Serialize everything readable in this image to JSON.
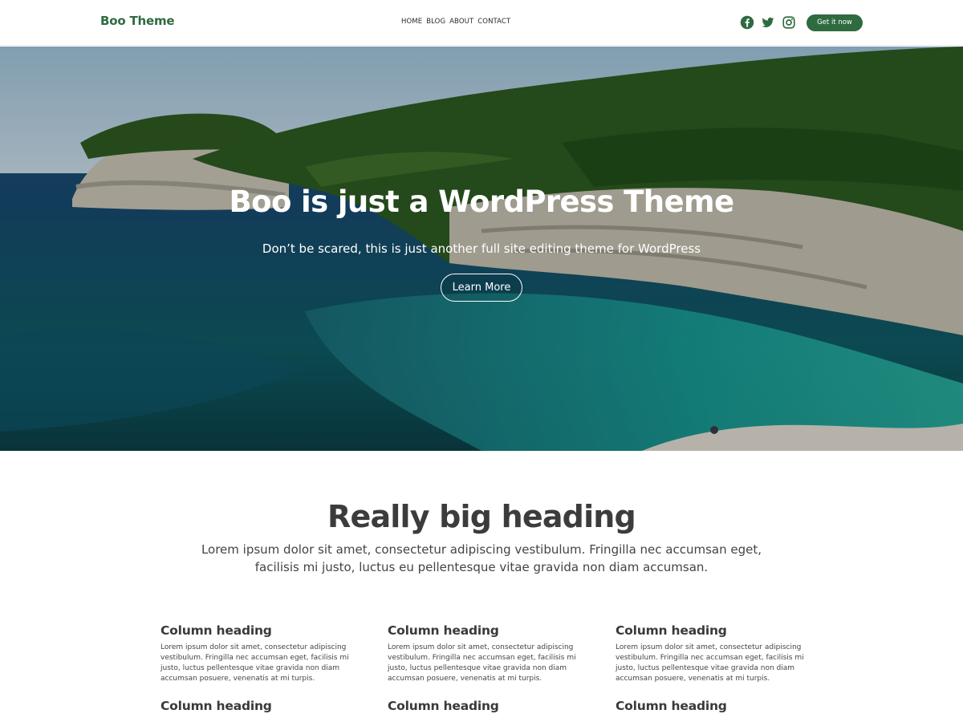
{
  "header": {
    "brand": "Boo Theme",
    "nav": [
      "HOME",
      "BLOG",
      "ABOUT",
      "CONTACT"
    ],
    "social_icons": [
      "facebook-icon",
      "twitter-icon",
      "instagram-icon"
    ],
    "cta_label": "Get it now",
    "accent_color": "#2e6b3f"
  },
  "hero": {
    "title": "Boo is just a WordPress Theme",
    "subtitle": "Don’t be scared, this is just another full site editing theme for WordPress",
    "button_label": "Learn More"
  },
  "intro": {
    "heading": "Really big heading",
    "text": "Lorem ipsum dolor sit amet, consectetur adipiscing vestibulum. Fringilla nec accumsan eget, facilisis mi justo, luctus eu pellentesque vitae gravida non diam accumsan."
  },
  "columns": [
    {
      "heading": "Column heading",
      "text": "Lorem ipsum dolor sit amet, consectetur adipiscing vestibulum. Fringilla nec accumsan eget, facilisis mi justo, luctus pellentesque vitae gravida non diam accumsan posuere, venenatis at mi turpis."
    },
    {
      "heading": "Column heading",
      "text": "Lorem ipsum dolor sit amet, consectetur adipiscing vestibulum. Fringilla nec accumsan eget, facilisis mi justo, luctus pellentesque vitae gravida non diam accumsan posuere, venenatis at mi turpis."
    },
    {
      "heading": "Column heading",
      "text": "Lorem ipsum dolor sit amet, consectetur adipiscing vestibulum. Fringilla nec accumsan eget, facilisis mi justo, luctus pellentesque vitae gravida non diam accumsan posuere, venenatis at mi turpis."
    },
    {
      "heading": "Column heading",
      "text": ""
    },
    {
      "heading": "Column heading",
      "text": ""
    },
    {
      "heading": "Column heading",
      "text": ""
    }
  ]
}
